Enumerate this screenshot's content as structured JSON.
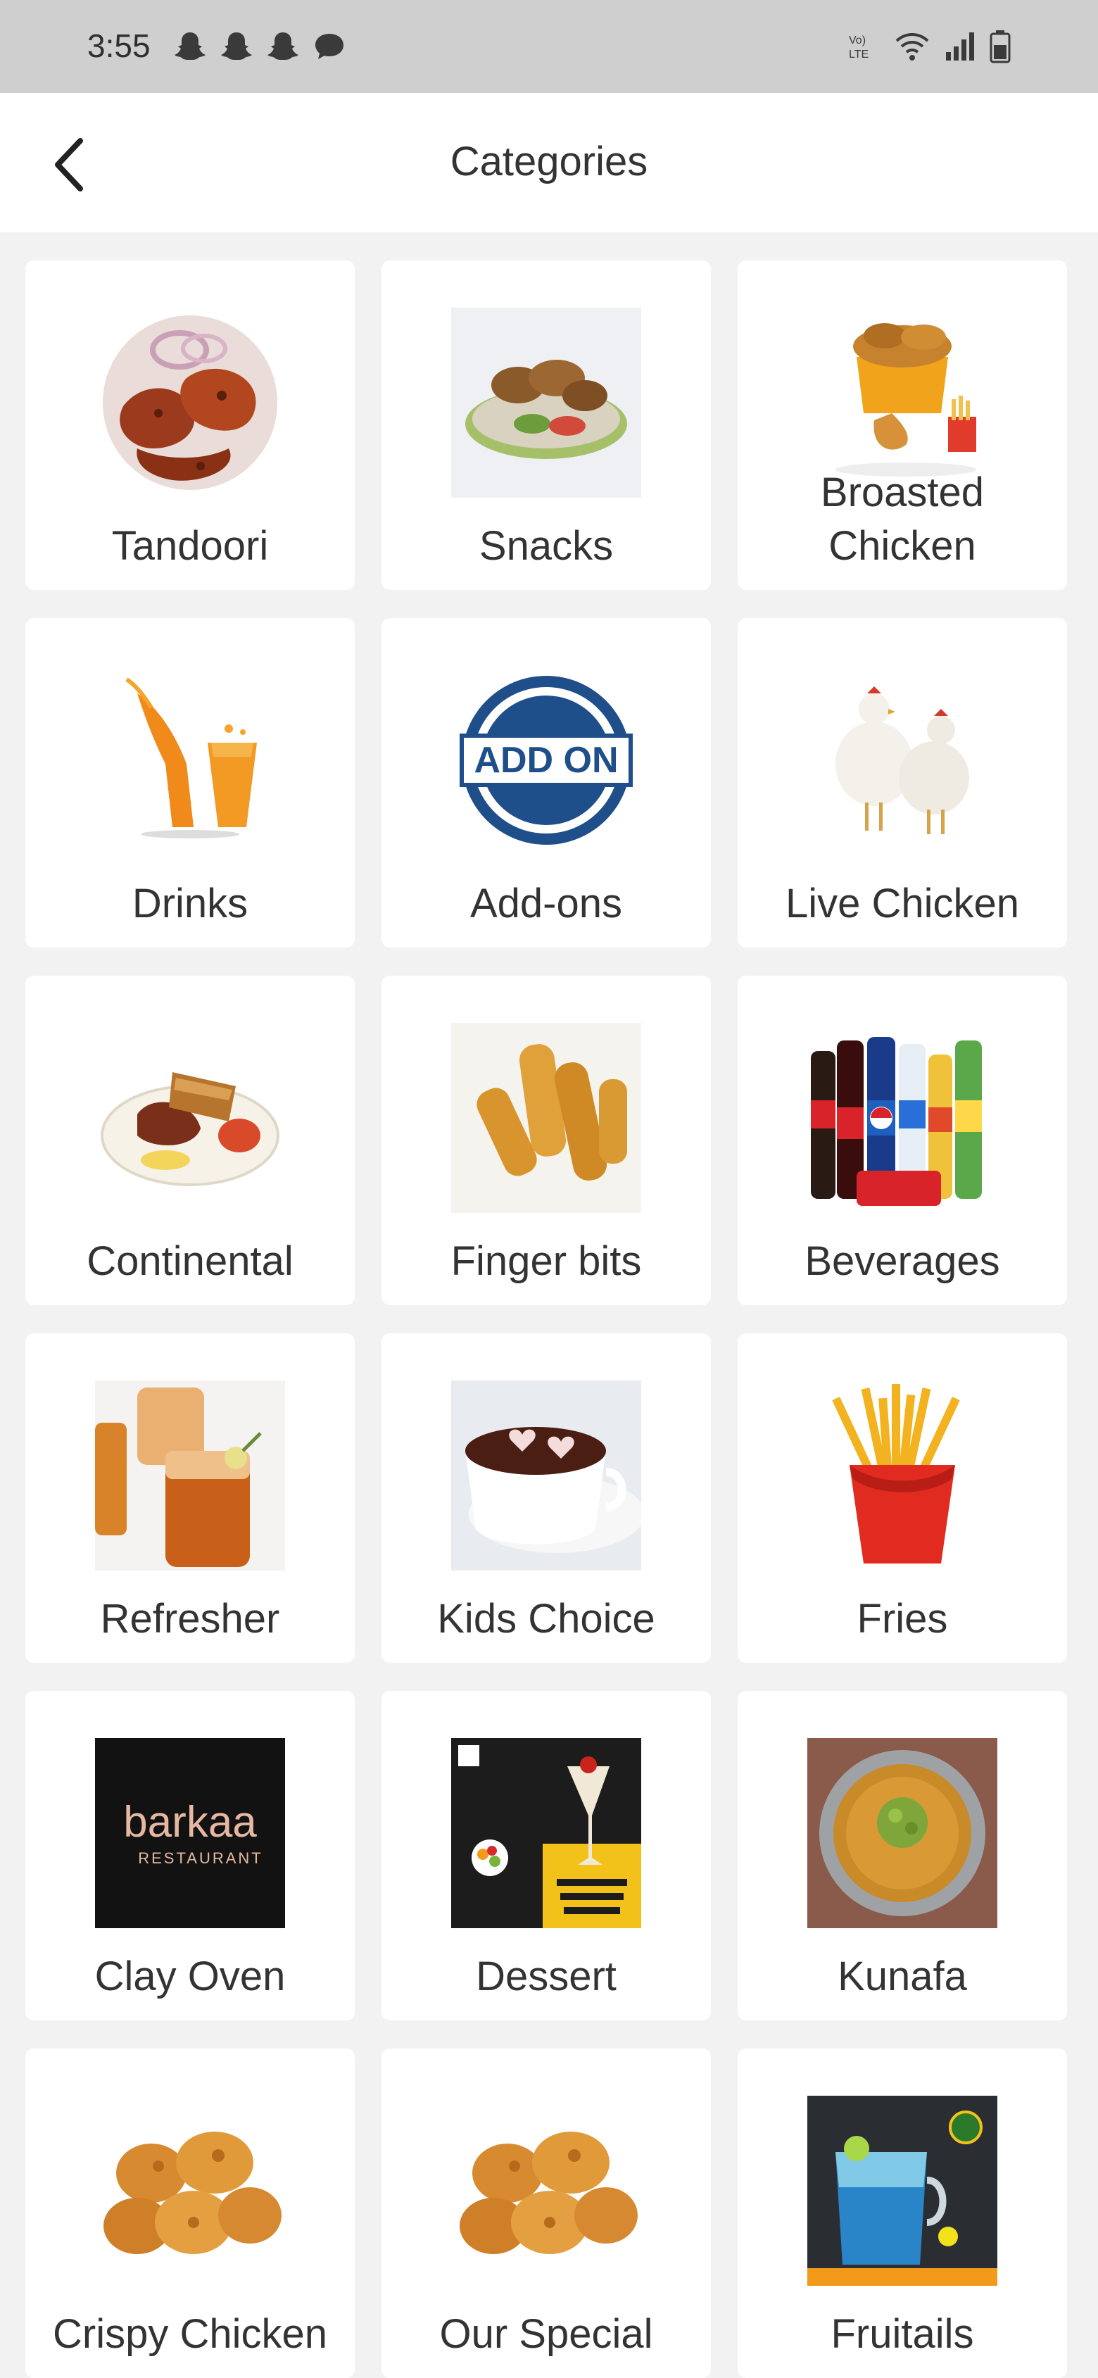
{
  "status_bar": {
    "time": "3:55",
    "left_icons": [
      "snapchat-icon",
      "snapchat-icon",
      "snapchat-icon",
      "chat-icon"
    ],
    "right_icons": [
      "volte-icon",
      "wifi-icon",
      "signal-icon",
      "battery-icon"
    ]
  },
  "header": {
    "title": "Categories",
    "back_icon": "back-arrow-icon"
  },
  "categories": [
    {
      "label": "Tandoori",
      "icon": "tandoori-image"
    },
    {
      "label": "Snacks",
      "icon": "snacks-image"
    },
    {
      "label": "Broasted Chicken",
      "icon": "broasted-chicken-image"
    },
    {
      "label": "Drinks",
      "icon": "drinks-image"
    },
    {
      "label": "Add-ons",
      "icon": "add-on-badge-image",
      "badge_text": "ADD ON"
    },
    {
      "label": "Live Chicken",
      "icon": "live-chicken-image"
    },
    {
      "label": "Continental",
      "icon": "continental-image"
    },
    {
      "label": "Finger bits",
      "icon": "finger-bits-image"
    },
    {
      "label": "Beverages",
      "icon": "beverages-image"
    },
    {
      "label": "Refresher",
      "icon": "refresher-image"
    },
    {
      "label": "Kids Choice",
      "icon": "kids-choice-image"
    },
    {
      "label": "Fries",
      "icon": "fries-image"
    },
    {
      "label": "Clay Oven",
      "icon": "clay-oven-image",
      "logo_text": "barkaa",
      "logo_subtext": "RESTAURANT"
    },
    {
      "label": "Dessert",
      "icon": "dessert-image"
    },
    {
      "label": "Kunafa",
      "icon": "kunafa-image"
    },
    {
      "label": "Crispy Chicken",
      "icon": "crispy-chicken-image"
    },
    {
      "label": "Our Special",
      "icon": "our-special-image"
    },
    {
      "label": "Fruitails",
      "icon": "fruitails-image"
    }
  ],
  "colors": {
    "status_bar_bg": "#cfcfcf",
    "app_bar_bg": "#ffffff",
    "page_bg": "#f2f2f2",
    "card_bg": "#ffffff",
    "text": "#333333"
  }
}
